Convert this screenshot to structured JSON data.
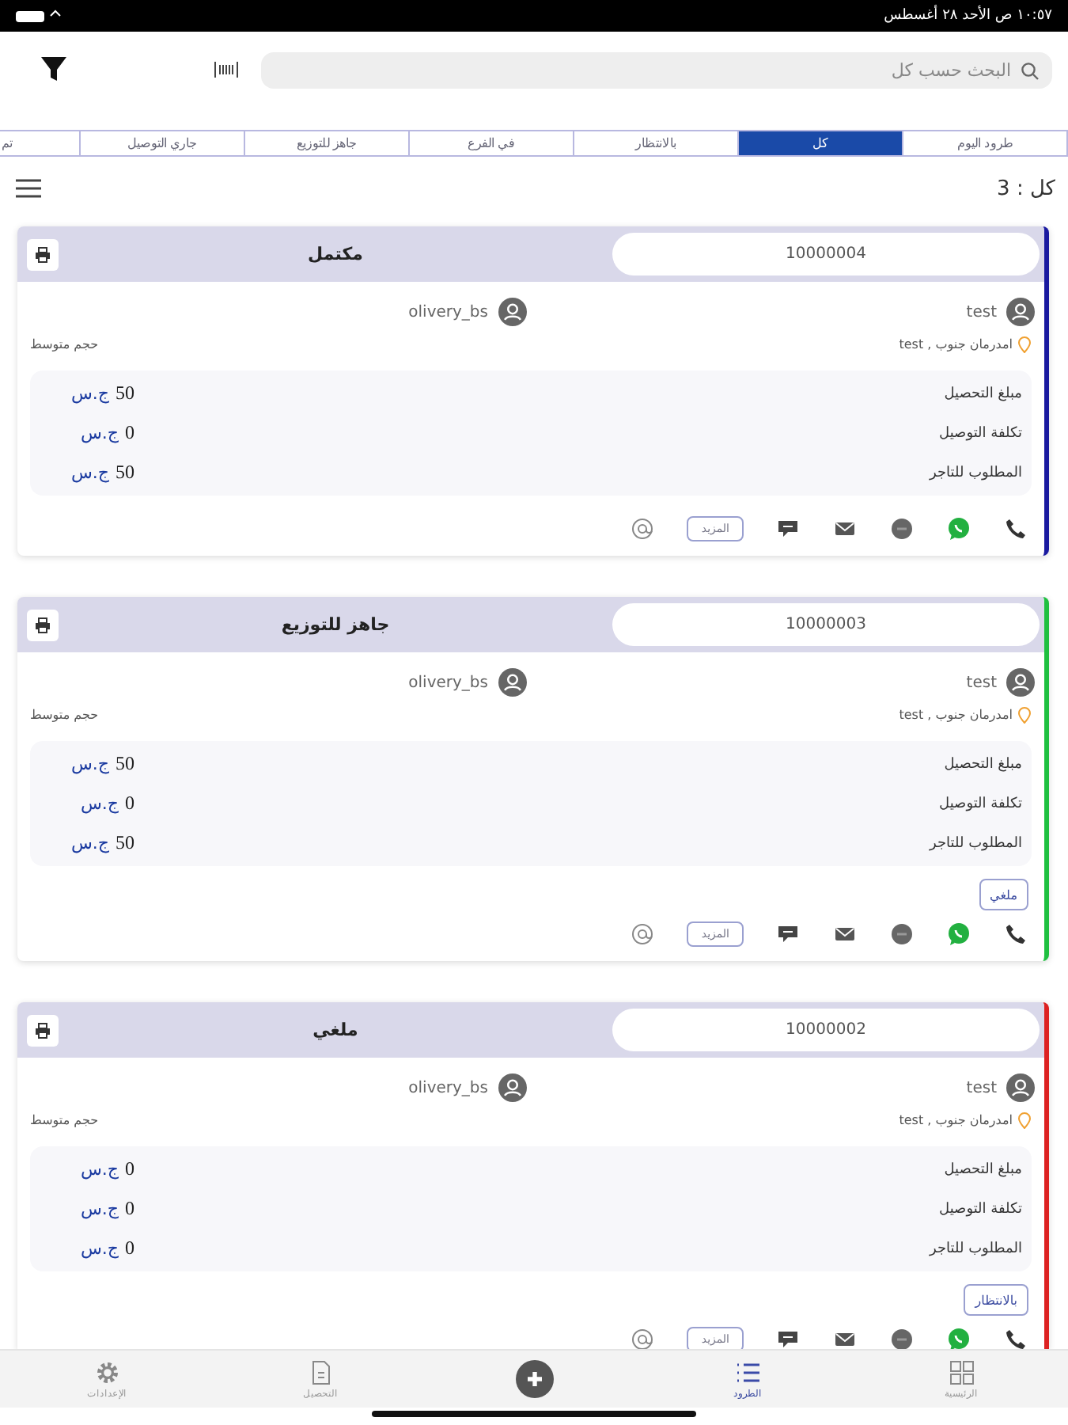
{
  "status_bar": {
    "time": "١٠:٥٧ ص  الأحد ٢٨ أغسطس"
  },
  "search": {
    "placeholder": "البحث حسب كل"
  },
  "tabs": [
    {
      "label": "طرود اليوم",
      "selected": false
    },
    {
      "label": "كل",
      "selected": true
    },
    {
      "label": "بالانتظار",
      "selected": false
    },
    {
      "label": "في الفرع",
      "selected": false
    },
    {
      "label": "جاهز للتوزيع",
      "selected": false
    },
    {
      "label": "جاري التوصيل",
      "selected": false
    },
    {
      "label": "تم",
      "selected": false
    }
  ],
  "count": "كل : 3",
  "orders": [
    {
      "id": "10000004",
      "status": "مكتمل",
      "color": "#1a1aa0",
      "sender": "test",
      "driver": "olivery_bs",
      "address": "امدرمان جنوب , test",
      "size": "حجم متوسط",
      "amounts": [
        {
          "label": "مبلغ التحصيل",
          "value": "50",
          "currency": "ج.س"
        },
        {
          "label": "تكلفة التوصيل",
          "value": "0",
          "currency": "ج.س"
        },
        {
          "label": "المطلوب للتاجر",
          "value": "50",
          "currency": "ج.س"
        }
      ],
      "more": "المزيد"
    },
    {
      "id": "10000003",
      "status": "جاهز للتوزيع",
      "color": "#1fc040",
      "sender": "test",
      "driver": "olivery_bs",
      "address": "امدرمان جنوب , test",
      "size": "حجم متوسط",
      "amounts": [
        {
          "label": "مبلغ التحصيل",
          "value": "50",
          "currency": "ج.س"
        },
        {
          "label": "تكلفة التوصيل",
          "value": "0",
          "currency": "ج.س"
        },
        {
          "label": "المطلوب للتاجر",
          "value": "50",
          "currency": "ج.س"
        }
      ],
      "action": "ملغي",
      "more": "المزيد"
    },
    {
      "id": "10000002",
      "status": "ملغي",
      "color": "#dd2222",
      "sender": "test",
      "driver": "olivery_bs",
      "address": "امدرمان جنوب , test",
      "size": "حجم متوسط",
      "amounts": [
        {
          "label": "مبلغ التحصيل",
          "value": "0",
          "currency": "ج.س"
        },
        {
          "label": "تكلفة التوصيل",
          "value": "0",
          "currency": "ج.س"
        },
        {
          "label": "المطلوب للتاجر",
          "value": "0",
          "currency": "ج.س"
        }
      ],
      "action": "بالانتظار",
      "more": "المزيد"
    }
  ],
  "nav": [
    {
      "kind": "grid",
      "label": "الرئيسية",
      "selected": false
    },
    {
      "kind": "list",
      "label": "الطرود",
      "selected": true
    },
    {
      "kind": "plus"
    },
    {
      "kind": "doc",
      "label": "التحصيل",
      "selected": false
    },
    {
      "kind": "gear",
      "label": "الإعدادات",
      "selected": false
    }
  ]
}
